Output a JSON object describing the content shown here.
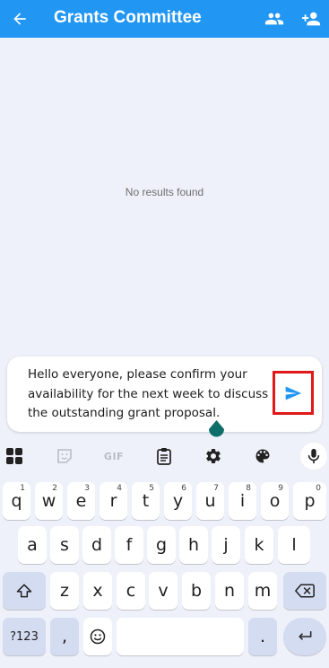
{
  "header": {
    "title": "Grants Committee",
    "background_color": "#2196f3",
    "back_icon": "arrow-left-icon",
    "actions": [
      {
        "icon": "group-icon"
      },
      {
        "icon": "person-add-icon"
      }
    ]
  },
  "content": {
    "empty_text": "No results found"
  },
  "composer": {
    "message": "Hello everyone, please confirm your availability for the next week to discuss the outstanding grant proposal.",
    "send_icon": "send-icon",
    "send_color": "#2196f3"
  },
  "keyboard": {
    "toolbar": [
      {
        "icon": "apps-grid-icon"
      },
      {
        "icon": "sticker-icon"
      },
      {
        "label": "GIF"
      },
      {
        "icon": "clipboard-icon"
      },
      {
        "icon": "settings-gear-icon"
      },
      {
        "icon": "palette-icon"
      },
      {
        "icon": "microphone-icon"
      }
    ],
    "row1": [
      {
        "k": "q",
        "h": "1"
      },
      {
        "k": "w",
        "h": "2"
      },
      {
        "k": "e",
        "h": "3"
      },
      {
        "k": "r",
        "h": "4"
      },
      {
        "k": "t",
        "h": "5"
      },
      {
        "k": "y",
        "h": "6"
      },
      {
        "k": "u",
        "h": "7"
      },
      {
        "k": "i",
        "h": "8"
      },
      {
        "k": "o",
        "h": "9"
      },
      {
        "k": "p",
        "h": "0"
      }
    ],
    "row2": [
      "a",
      "s",
      "d",
      "f",
      "g",
      "h",
      "j",
      "k",
      "l"
    ],
    "row3": [
      "z",
      "x",
      "c",
      "v",
      "b",
      "n",
      "m"
    ],
    "symbols_label": "?123",
    "comma_label": ",",
    "period_label": ".",
    "emoji_icon": "emoji-smile-icon",
    "shift_icon": "shift-icon",
    "backspace_icon": "backspace-icon",
    "enter_icon": "enter-icon"
  }
}
